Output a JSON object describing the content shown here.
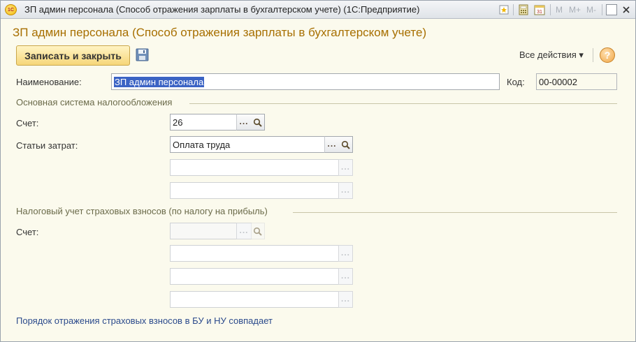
{
  "window": {
    "title": "ЗП админ персонала (Способ отражения зарплаты  в бухгалтерском учете)  (1С:Предприятие)",
    "logo_text": "1С",
    "toolbar": [
      "M",
      "M+",
      "M-"
    ]
  },
  "form": {
    "title": "ЗП админ персонала (Способ отражения зарплаты  в бухгалтерском учете)",
    "save_close_label": "Записать и закрыть",
    "all_actions_label": "Все действия ▾",
    "help_label": "?"
  },
  "fields": {
    "name_label": "Наименование:",
    "name_value": "ЗП админ персонала",
    "code_label": "Код:",
    "code_value": "00-00002"
  },
  "main_tax": {
    "section_title": "Основная система налогообложения",
    "account_label": "Счет:",
    "account_value": "26",
    "cost_label": "Статьи затрат:",
    "cost_value": "Оплата труда",
    "subconto2": "",
    "subconto3": ""
  },
  "insurance_tax": {
    "section_title": "Налоговый учет страховых взносов (по налогу на прибыль)",
    "account_label": "Счет:",
    "account_value": "",
    "sub1": "",
    "sub2": "",
    "sub3": ""
  },
  "footer": {
    "link_text": "Порядок отражения страховых взносов в БУ и НУ совпадает"
  },
  "colors": {
    "title_accent": "#a76f00",
    "primary_button": "#f6d679",
    "selection": "#3b63c4",
    "link": "#2b4a8c"
  }
}
